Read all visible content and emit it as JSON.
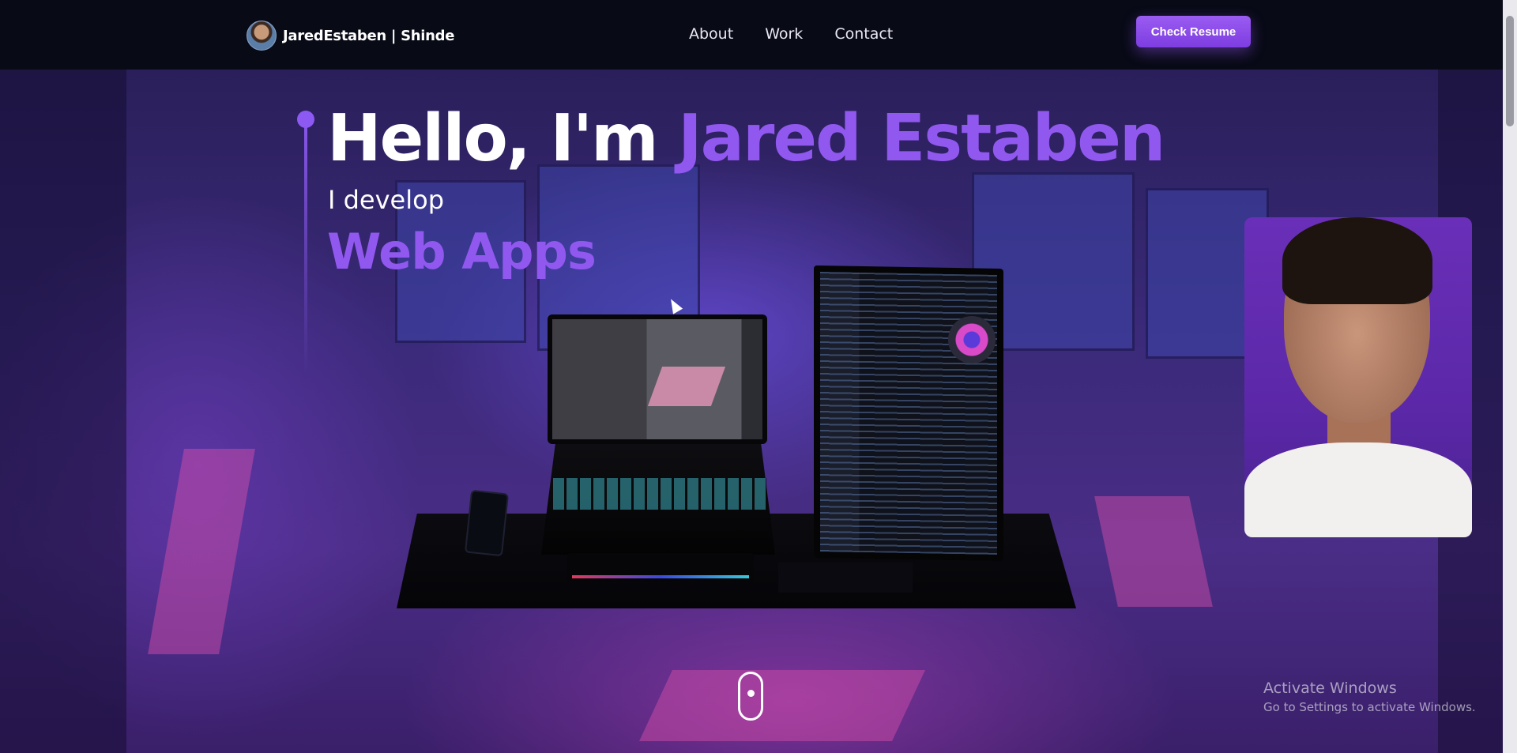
{
  "nav": {
    "brand": "JaredEstaben | Shinde",
    "links": [
      "About",
      "Work",
      "Contact"
    ],
    "resume_button": "Check Resume"
  },
  "hero": {
    "greeting": "Hello, I'm",
    "name": "Jared Estaben",
    "subtitle": "I develop",
    "role": "Web Apps"
  },
  "watermark": {
    "title": "Activate Windows",
    "subtitle": "Go to Settings to activate Windows."
  },
  "colors": {
    "accent": "#9158ef",
    "button": "#8b4cec",
    "nav_bg": "#080a16"
  },
  "icons": {
    "scroll_indicator": "mouse-scroll-icon",
    "cursor": "arrow-cursor-icon"
  }
}
